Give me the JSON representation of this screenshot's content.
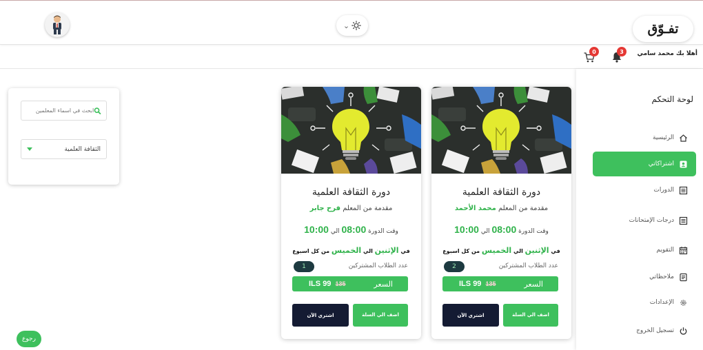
{
  "header": {
    "logo": "تفـوّق",
    "avatar_icon": "person-avatar-icon",
    "theme_icon": "sun-icon"
  },
  "subbar": {
    "greeting": "أهلا بك محمد سامي",
    "notifications_count": "3",
    "cart_count": "0"
  },
  "sidebar": {
    "title": "لوحة التحكم",
    "items": [
      {
        "label": "الرئيسية",
        "icon": "home-icon",
        "active": false
      },
      {
        "label": "اشتراكاتي",
        "icon": "id-card-icon",
        "active": true
      },
      {
        "label": "الدورات",
        "icon": "list-icon",
        "active": false
      },
      {
        "label": "درجات الإمتحانات",
        "icon": "list-icon",
        "active": false
      },
      {
        "label": "التقويم",
        "icon": "calendar-icon",
        "active": false
      },
      {
        "label": "ملاحظاتي",
        "icon": "notes-icon",
        "active": false
      },
      {
        "label": "الإعدادات",
        "icon": "gear-icon",
        "active": false
      },
      {
        "label": "تسجيل الخروج",
        "icon": "power-icon",
        "active": false
      }
    ]
  },
  "filters": {
    "search_placeholder": "ابحث في اسماء المعلمين",
    "category_selected": "الثقافة العلمية"
  },
  "cards": [
    {
      "title": "دورة الثقافة العلمية",
      "teacher_prefix": "مقدمة من المعلم",
      "teacher_name": "محمد الأحمد",
      "time_prefix": "وقت الدورة",
      "time_from": "08:00",
      "time_sep": "الي",
      "time_to": "10:00",
      "days_prefix": "في",
      "day_from": "الإثنين",
      "days_sep": "الي",
      "day_to": "الخميس",
      "days_suffix": "من كل اسبوع",
      "students_label": "عدد الطلاب المشتركين",
      "students_count": "2",
      "price_label": "السعر",
      "price_old": "135",
      "price_new": "99",
      "currency": "ILS",
      "add_to_cart": "اضف الي السلة",
      "buy_now": "اشتري الآن"
    },
    {
      "title": "دورة الثقافة العلمية",
      "teacher_prefix": "مقدمة من المعلم",
      "teacher_name": "فرح جابر",
      "time_prefix": "وقت الدورة",
      "time_from": "08:00",
      "time_sep": "الي",
      "time_to": "10:00",
      "days_prefix": "في",
      "day_from": "الإثنين",
      "days_sep": "الي",
      "day_to": "الخميس",
      "days_suffix": "من كل اسبوع",
      "students_label": "عدد الطلاب المشتركين",
      "students_count": "1",
      "price_label": "السعر",
      "price_old": "135",
      "price_new": "99",
      "currency": "ILS",
      "add_to_cart": "اضف الي السلة",
      "buy_now": "اشتري الآن"
    }
  ],
  "back_button": "رجوع",
  "colors": {
    "accent": "#3ec05d",
    "dark_button": "#141b33",
    "badge": "#e53935"
  }
}
